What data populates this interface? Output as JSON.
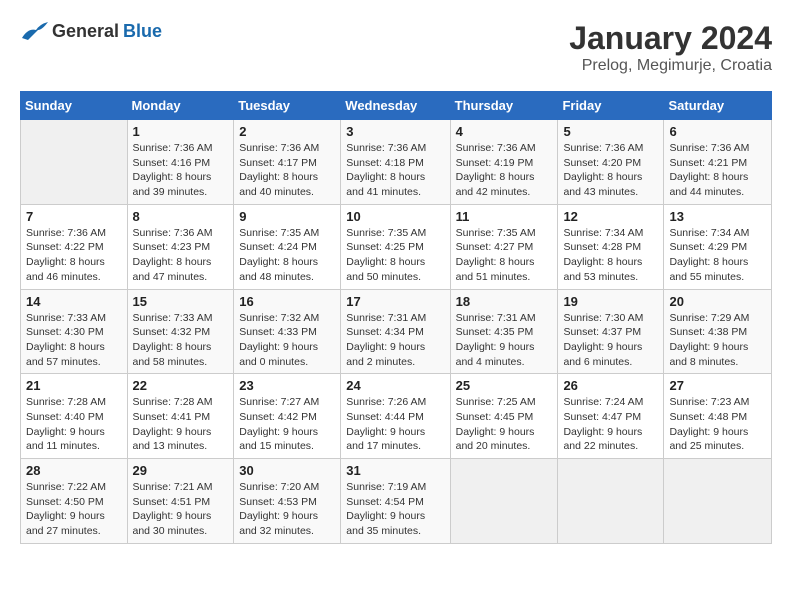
{
  "header": {
    "logo": {
      "general": "General",
      "blue": "Blue"
    },
    "title": "January 2024",
    "location": "Prelog, Megimurje, Croatia"
  },
  "days_of_week": [
    "Sunday",
    "Monday",
    "Tuesday",
    "Wednesday",
    "Thursday",
    "Friday",
    "Saturday"
  ],
  "weeks": [
    [
      {
        "day": "",
        "info": ""
      },
      {
        "day": "1",
        "info": "Sunrise: 7:36 AM\nSunset: 4:16 PM\nDaylight: 8 hours\nand 39 minutes."
      },
      {
        "day": "2",
        "info": "Sunrise: 7:36 AM\nSunset: 4:17 PM\nDaylight: 8 hours\nand 40 minutes."
      },
      {
        "day": "3",
        "info": "Sunrise: 7:36 AM\nSunset: 4:18 PM\nDaylight: 8 hours\nand 41 minutes."
      },
      {
        "day": "4",
        "info": "Sunrise: 7:36 AM\nSunset: 4:19 PM\nDaylight: 8 hours\nand 42 minutes."
      },
      {
        "day": "5",
        "info": "Sunrise: 7:36 AM\nSunset: 4:20 PM\nDaylight: 8 hours\nand 43 minutes."
      },
      {
        "day": "6",
        "info": "Sunrise: 7:36 AM\nSunset: 4:21 PM\nDaylight: 8 hours\nand 44 minutes."
      }
    ],
    [
      {
        "day": "7",
        "info": "Sunrise: 7:36 AM\nSunset: 4:22 PM\nDaylight: 8 hours\nand 46 minutes."
      },
      {
        "day": "8",
        "info": "Sunrise: 7:36 AM\nSunset: 4:23 PM\nDaylight: 8 hours\nand 47 minutes."
      },
      {
        "day": "9",
        "info": "Sunrise: 7:35 AM\nSunset: 4:24 PM\nDaylight: 8 hours\nand 48 minutes."
      },
      {
        "day": "10",
        "info": "Sunrise: 7:35 AM\nSunset: 4:25 PM\nDaylight: 8 hours\nand 50 minutes."
      },
      {
        "day": "11",
        "info": "Sunrise: 7:35 AM\nSunset: 4:27 PM\nDaylight: 8 hours\nand 51 minutes."
      },
      {
        "day": "12",
        "info": "Sunrise: 7:34 AM\nSunset: 4:28 PM\nDaylight: 8 hours\nand 53 minutes."
      },
      {
        "day": "13",
        "info": "Sunrise: 7:34 AM\nSunset: 4:29 PM\nDaylight: 8 hours\nand 55 minutes."
      }
    ],
    [
      {
        "day": "14",
        "info": "Sunrise: 7:33 AM\nSunset: 4:30 PM\nDaylight: 8 hours\nand 57 minutes."
      },
      {
        "day": "15",
        "info": "Sunrise: 7:33 AM\nSunset: 4:32 PM\nDaylight: 8 hours\nand 58 minutes."
      },
      {
        "day": "16",
        "info": "Sunrise: 7:32 AM\nSunset: 4:33 PM\nDaylight: 9 hours\nand 0 minutes."
      },
      {
        "day": "17",
        "info": "Sunrise: 7:31 AM\nSunset: 4:34 PM\nDaylight: 9 hours\nand 2 minutes."
      },
      {
        "day": "18",
        "info": "Sunrise: 7:31 AM\nSunset: 4:35 PM\nDaylight: 9 hours\nand 4 minutes."
      },
      {
        "day": "19",
        "info": "Sunrise: 7:30 AM\nSunset: 4:37 PM\nDaylight: 9 hours\nand 6 minutes."
      },
      {
        "day": "20",
        "info": "Sunrise: 7:29 AM\nSunset: 4:38 PM\nDaylight: 9 hours\nand 8 minutes."
      }
    ],
    [
      {
        "day": "21",
        "info": "Sunrise: 7:28 AM\nSunset: 4:40 PM\nDaylight: 9 hours\nand 11 minutes."
      },
      {
        "day": "22",
        "info": "Sunrise: 7:28 AM\nSunset: 4:41 PM\nDaylight: 9 hours\nand 13 minutes."
      },
      {
        "day": "23",
        "info": "Sunrise: 7:27 AM\nSunset: 4:42 PM\nDaylight: 9 hours\nand 15 minutes."
      },
      {
        "day": "24",
        "info": "Sunrise: 7:26 AM\nSunset: 4:44 PM\nDaylight: 9 hours\nand 17 minutes."
      },
      {
        "day": "25",
        "info": "Sunrise: 7:25 AM\nSunset: 4:45 PM\nDaylight: 9 hours\nand 20 minutes."
      },
      {
        "day": "26",
        "info": "Sunrise: 7:24 AM\nSunset: 4:47 PM\nDaylight: 9 hours\nand 22 minutes."
      },
      {
        "day": "27",
        "info": "Sunrise: 7:23 AM\nSunset: 4:48 PM\nDaylight: 9 hours\nand 25 minutes."
      }
    ],
    [
      {
        "day": "28",
        "info": "Sunrise: 7:22 AM\nSunset: 4:50 PM\nDaylight: 9 hours\nand 27 minutes."
      },
      {
        "day": "29",
        "info": "Sunrise: 7:21 AM\nSunset: 4:51 PM\nDaylight: 9 hours\nand 30 minutes."
      },
      {
        "day": "30",
        "info": "Sunrise: 7:20 AM\nSunset: 4:53 PM\nDaylight: 9 hours\nand 32 minutes."
      },
      {
        "day": "31",
        "info": "Sunrise: 7:19 AM\nSunset: 4:54 PM\nDaylight: 9 hours\nand 35 minutes."
      },
      {
        "day": "",
        "info": ""
      },
      {
        "day": "",
        "info": ""
      },
      {
        "day": "",
        "info": ""
      }
    ]
  ]
}
